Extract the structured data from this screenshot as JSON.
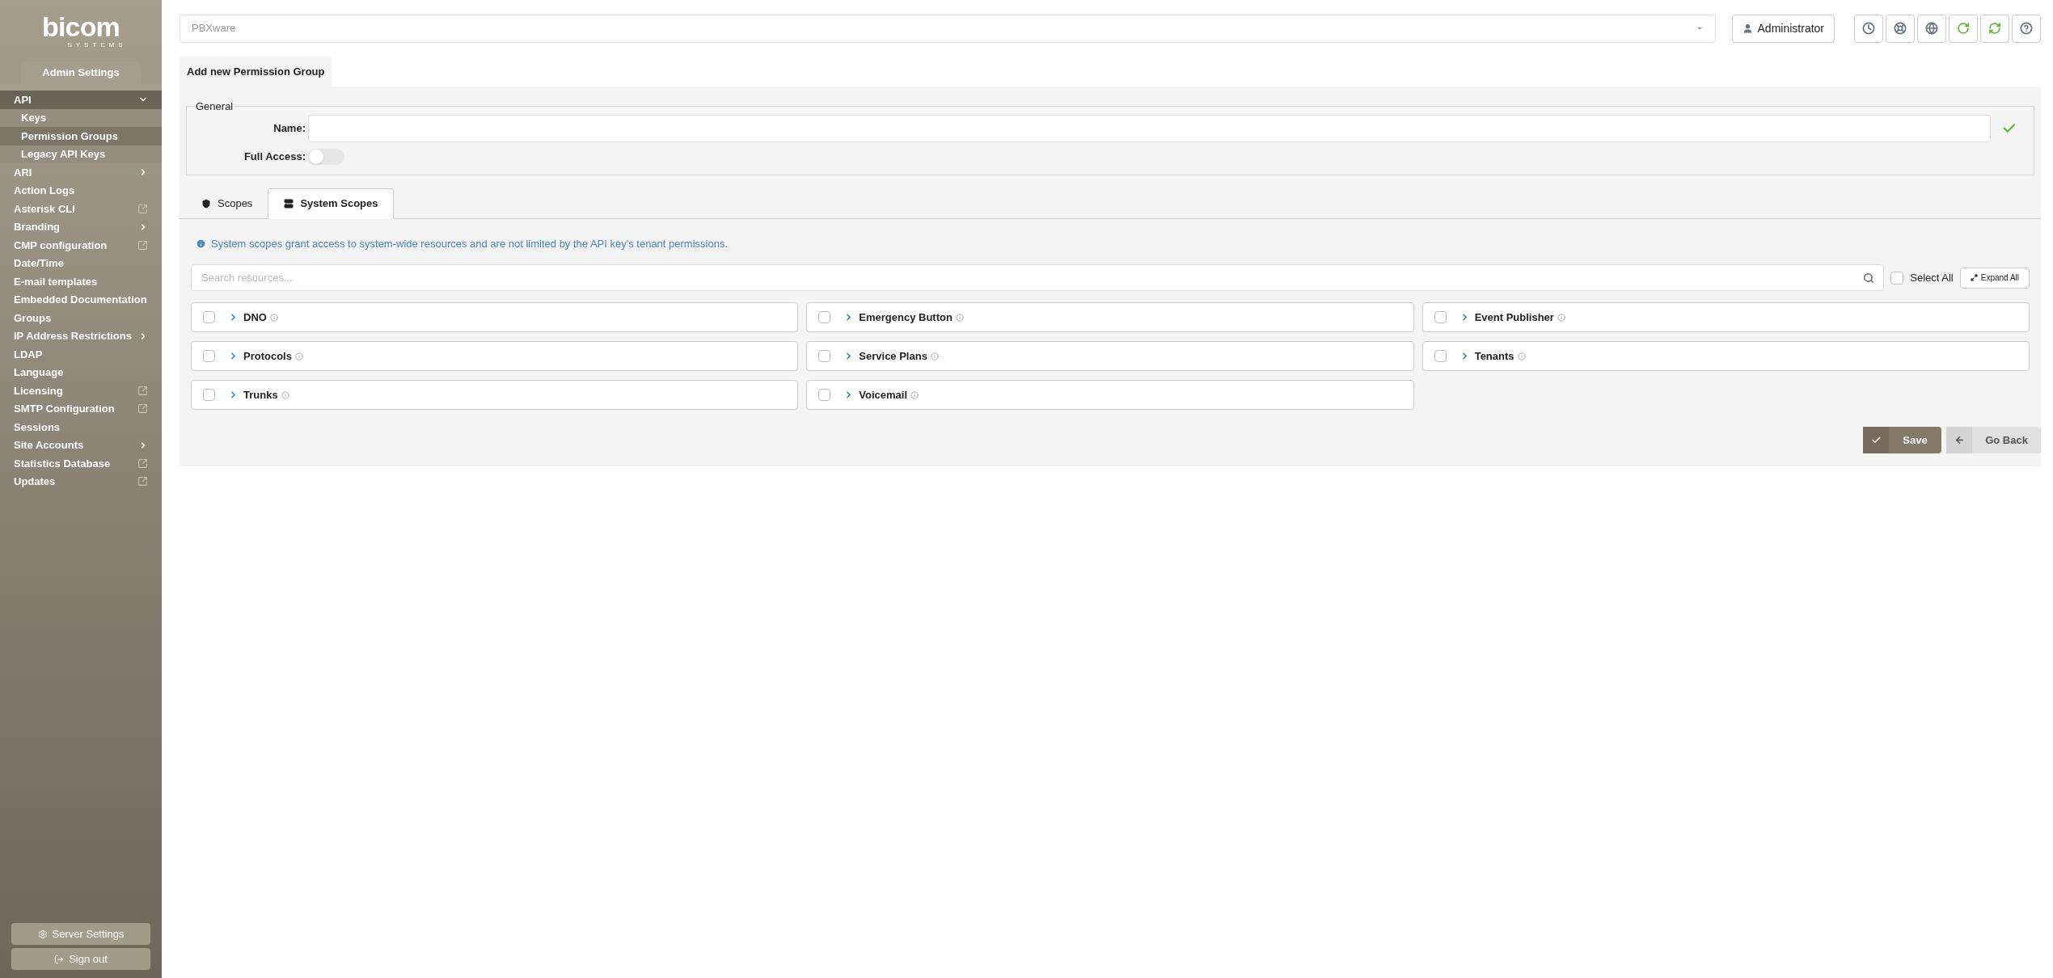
{
  "logo": {
    "name": "bicom",
    "tagline": "SYSTEMS"
  },
  "sidebar": {
    "header": "Admin Settings",
    "items": [
      {
        "label": "API",
        "kind": "expand",
        "expanded": true,
        "children": [
          {
            "label": "Keys",
            "selected": false
          },
          {
            "label": "Permission Groups",
            "selected": true
          },
          {
            "label": "Legacy API Keys",
            "selected": false
          }
        ]
      },
      {
        "label": "ARI",
        "kind": "expand",
        "expanded": false
      },
      {
        "label": "Action Logs",
        "kind": "plain"
      },
      {
        "label": "Asterisk CLI",
        "kind": "external"
      },
      {
        "label": "Branding",
        "kind": "expand",
        "expanded": false
      },
      {
        "label": "CMP configuration",
        "kind": "external"
      },
      {
        "label": "Date/Time",
        "kind": "plain"
      },
      {
        "label": "E-mail templates",
        "kind": "plain"
      },
      {
        "label": "Embedded Documentation",
        "kind": "plain"
      },
      {
        "label": "Groups",
        "kind": "plain"
      },
      {
        "label": "IP Address Restrictions",
        "kind": "expand",
        "expanded": false
      },
      {
        "label": "LDAP",
        "kind": "plain"
      },
      {
        "label": "Language",
        "kind": "plain"
      },
      {
        "label": "Licensing",
        "kind": "external"
      },
      {
        "label": "SMTP Configuration",
        "kind": "external"
      },
      {
        "label": "Sessions",
        "kind": "plain"
      },
      {
        "label": "Site Accounts",
        "kind": "expand",
        "expanded": false
      },
      {
        "label": "Statistics Database",
        "kind": "external"
      },
      {
        "label": "Updates",
        "kind": "external"
      }
    ],
    "footer_buttons": [
      {
        "label": "Server Settings",
        "kind": "settings"
      },
      {
        "label": "Sign out",
        "kind": "signout"
      }
    ]
  },
  "top_bar": {
    "server_select": "PBXware",
    "user_button": "Administrator",
    "tools": [
      {
        "kind": "clock"
      },
      {
        "kind": "support"
      },
      {
        "kind": "globe"
      },
      {
        "kind": "reload"
      },
      {
        "kind": "sync"
      },
      {
        "kind": "help"
      }
    ]
  },
  "page_tab": "Add new Permission Group",
  "general": {
    "legend": "General",
    "name_label": "Name:",
    "name_valid": true,
    "full_access_label": "Full Access:",
    "full_access_on": false
  },
  "scope_tabs": [
    {
      "label": "Scopes",
      "kind": "shield",
      "selected": false
    },
    {
      "label": "System Scopes",
      "kind": "server",
      "selected": true
    }
  ],
  "info": "System scopes grant access to system-wide resources and are not limited by the API key's tenant permissions.",
  "search": {
    "placeholder": "Search resources..."
  },
  "select_all": {
    "label": "Select All",
    "checked": false
  },
  "expand_all": "Expand All",
  "resources": [
    {
      "name": "DNO",
      "checked": false
    },
    {
      "name": "Emergency Button",
      "checked": false
    },
    {
      "name": "Event Publisher",
      "checked": false
    },
    {
      "name": "Protocols",
      "checked": false
    },
    {
      "name": "Service Plans",
      "checked": false
    },
    {
      "name": "Tenants",
      "checked": false
    },
    {
      "name": "Trunks",
      "checked": false
    },
    {
      "name": "Voicemail",
      "checked": false
    }
  ],
  "actions": {
    "save": "Save",
    "back": "Go Back"
  }
}
